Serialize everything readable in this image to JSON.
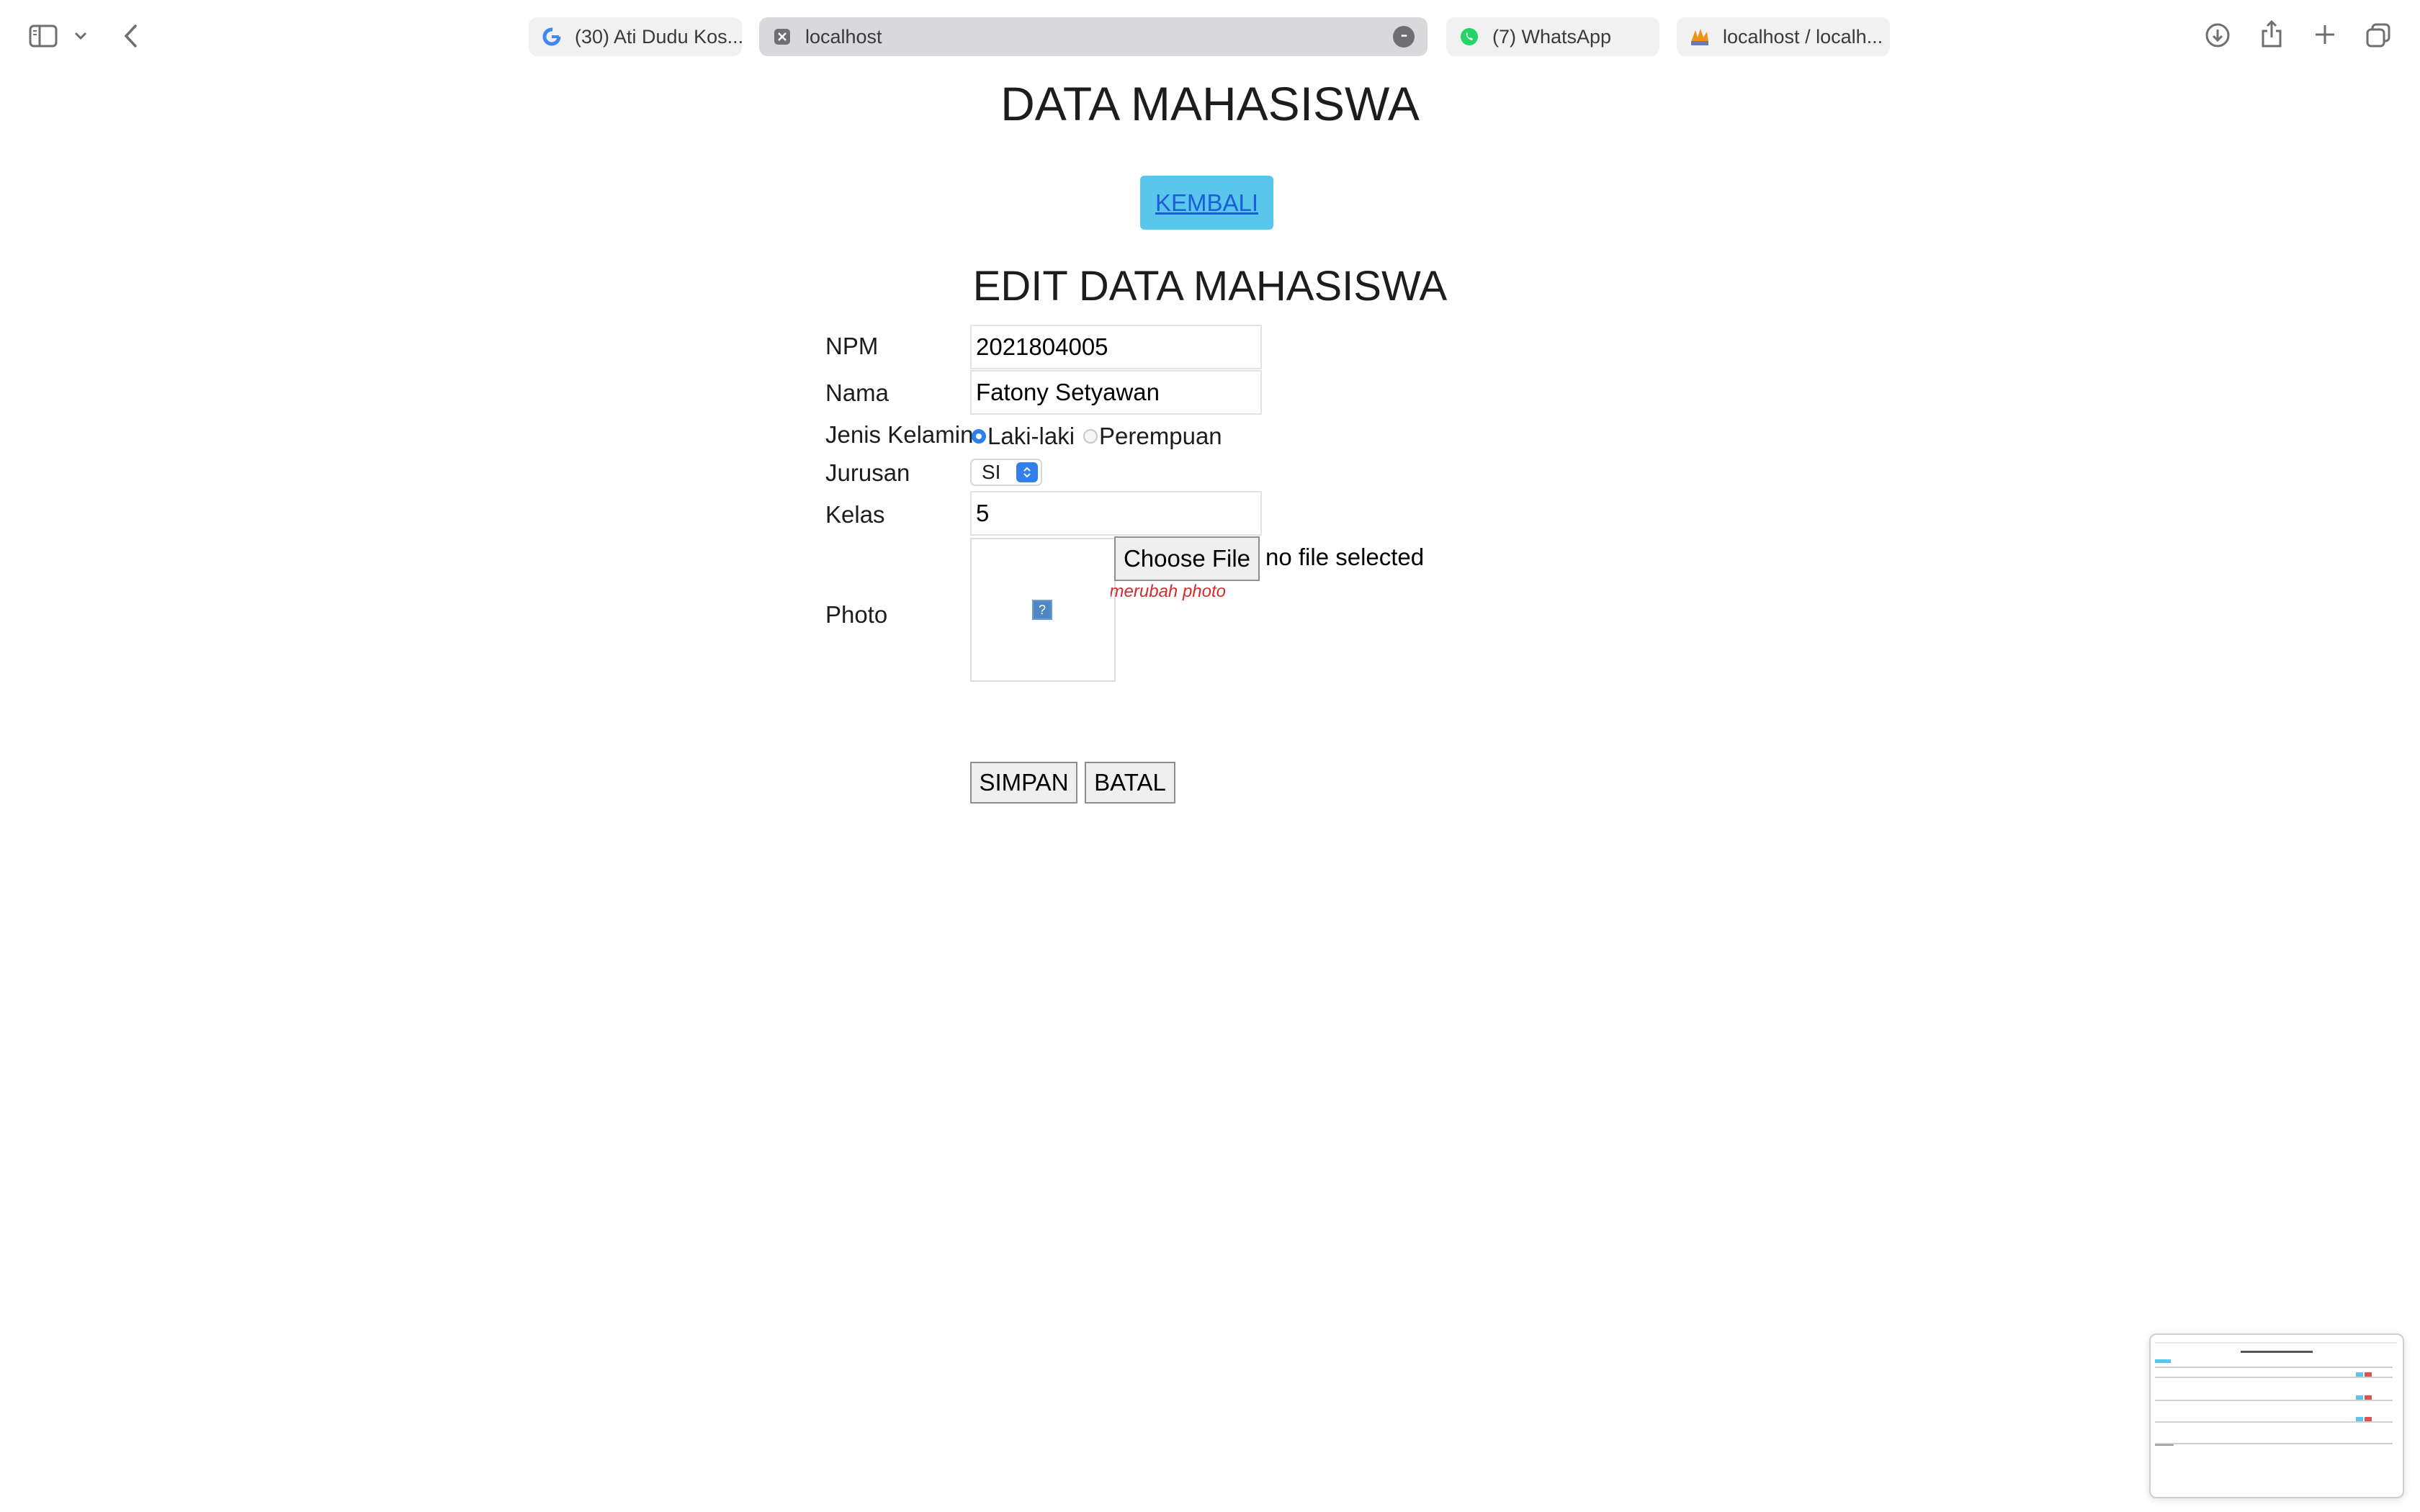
{
  "browser": {
    "tabs": [
      {
        "title": "(30) Ati Dudu Kos...",
        "favicon": "google-icon"
      },
      {
        "title": "localhost",
        "favicon": "close-icon",
        "active": true
      },
      {
        "title": "(7) WhatsApp",
        "favicon": "whatsapp-icon"
      },
      {
        "title": "localhost / localh...",
        "favicon": "phpmyadmin-icon"
      }
    ],
    "more_symbol": "•••"
  },
  "page": {
    "title": "DATA MAHASISWA",
    "back_label": "KEMBALI",
    "section_title": "EDIT DATA MAHASISWA"
  },
  "form": {
    "npm_label": "NPM",
    "npm_value": "2021804005",
    "nama_label": "Nama",
    "nama_value": "Fatony Setyawan",
    "gender_label": "Jenis Kelamin",
    "gender_options": [
      "Laki-laki",
      "Perempuan"
    ],
    "gender_selected": "Laki-laki",
    "jurusan_label": "Jurusan",
    "jurusan_value": "SI",
    "kelas_label": "Kelas",
    "kelas_value": "5",
    "photo_label": "Photo",
    "file_button": "Choose File",
    "file_status": "no file selected",
    "photo_hint": "merubah photo",
    "broken_image_glyph": "?",
    "save_label": "SIMPAN",
    "cancel_label": "BATAL"
  },
  "colors": {
    "back_button_bg": "#5bc6ec",
    "link": "#1a5fd6",
    "accent": "#2f80ed",
    "hint": "#d12d2d"
  }
}
